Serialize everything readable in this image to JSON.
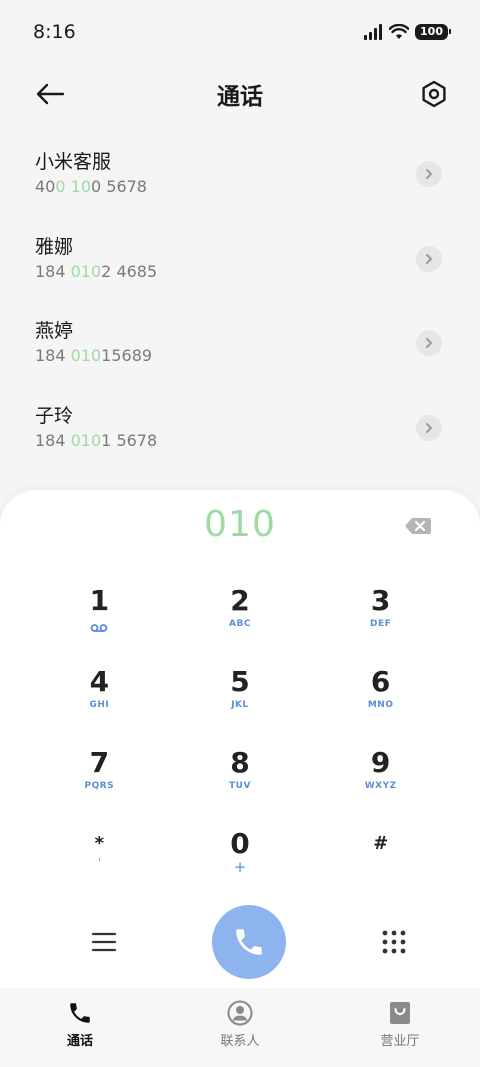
{
  "status": {
    "time": "8:16",
    "battery": "100"
  },
  "header": {
    "title": "通话"
  },
  "results": [
    {
      "name": "小米客服",
      "num_parts": [
        {
          "t": "40",
          "h": false
        },
        {
          "t": "0",
          "h": true
        },
        {
          "t": " ",
          "h": false
        },
        {
          "t": "10",
          "h": true
        },
        {
          "t": "0 5678",
          "h": false
        }
      ]
    },
    {
      "name": "雅娜",
      "num_parts": [
        {
          "t": "184 ",
          "h": false
        },
        {
          "t": "010",
          "h": true
        },
        {
          "t": "2 4685",
          "h": false
        }
      ]
    },
    {
      "name": "燕婷",
      "num_parts": [
        {
          "t": "184 ",
          "h": false
        },
        {
          "t": "010",
          "h": true
        },
        {
          "t": "15689",
          "h": false
        }
      ]
    },
    {
      "name": "子玲",
      "num_parts": [
        {
          "t": "184 ",
          "h": false
        },
        {
          "t": "010",
          "h": true
        },
        {
          "t": "1 5678",
          "h": false
        }
      ]
    }
  ],
  "dialer": {
    "input": "010",
    "keys": [
      {
        "digit": "1",
        "sub": ""
      },
      {
        "digit": "2",
        "sub": "ABC"
      },
      {
        "digit": "3",
        "sub": "DEF"
      },
      {
        "digit": "4",
        "sub": "GHI"
      },
      {
        "digit": "5",
        "sub": "JKL"
      },
      {
        "digit": "6",
        "sub": "MNO"
      },
      {
        "digit": "7",
        "sub": "PQRS"
      },
      {
        "digit": "8",
        "sub": "TUV"
      },
      {
        "digit": "9",
        "sub": "WXYZ"
      },
      {
        "digit": "*",
        "sub": "'"
      },
      {
        "digit": "0",
        "sub": "+"
      },
      {
        "digit": "#",
        "sub": ""
      }
    ]
  },
  "nav": [
    {
      "label": "通话",
      "icon": "phone-icon",
      "active": true
    },
    {
      "label": "联系人",
      "icon": "person-icon",
      "active": false
    },
    {
      "label": "营业厅",
      "icon": "shopping-bag-icon",
      "active": false
    }
  ],
  "colors": {
    "highlight": "#9fdaa4",
    "call_button": "#8db4ee",
    "key_letters": "#5b8ed6"
  }
}
